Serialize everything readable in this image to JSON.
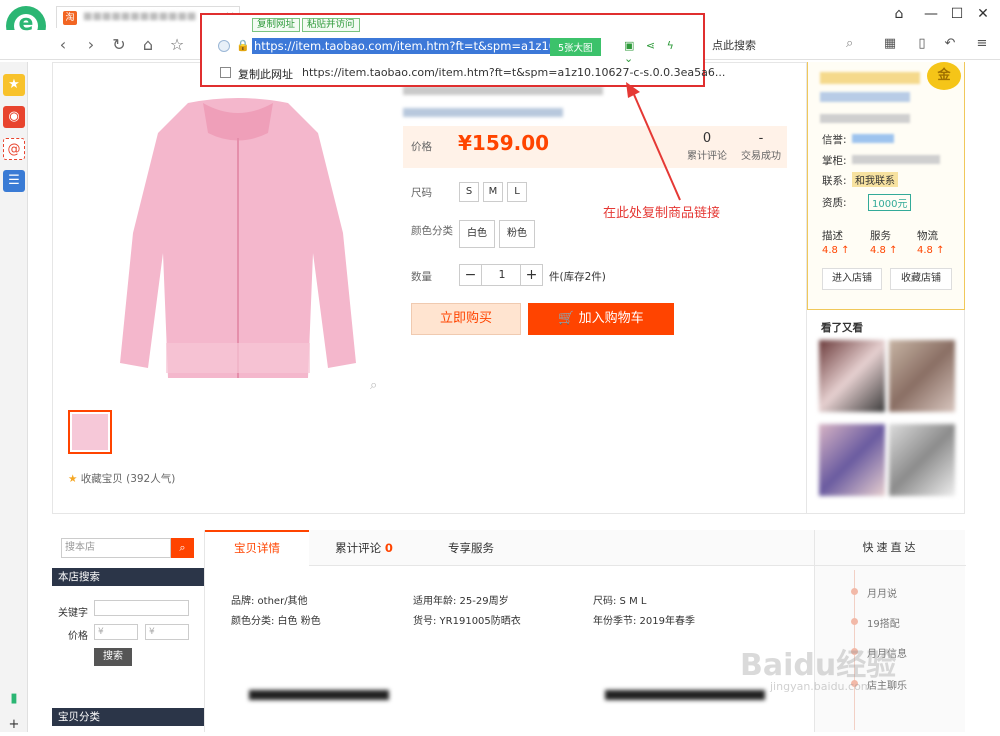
{
  "browser": {
    "tab_favicon": "淘",
    "tab_close": "×",
    "search_label": "点此搜索",
    "colors": {
      "brand_green": "#2bb673",
      "highlight_red": "#e02f2f",
      "url_select": "#3c78d8"
    }
  },
  "url_popup": {
    "copy_url_chip": "复制网址",
    "paste_visit_chip": "粘贴并访问",
    "url": "https://item.taobao.com/item.htm?ft=t&spm=a1z10.1",
    "big_image_button": "5张大图",
    "copy_this_label": "复制此网址",
    "full_url": "https://item.taobao.com/item.htm?ft=t&spm=a1z10.10627-c-s.0.0.3ea5a6..."
  },
  "product": {
    "price_label": "价格",
    "price": "¥159.00",
    "review_count": "0",
    "review_label": "累计评论",
    "sales_count": "-",
    "sales_label": "交易成功",
    "size_label": "尺码",
    "sizes": [
      "S",
      "M",
      "L"
    ],
    "color_label": "颜色分类",
    "colors": [
      "白色",
      "粉色"
    ],
    "qty_label": "数量",
    "qty_minus": "−",
    "qty_value": "1",
    "qty_plus": "+",
    "qty_unit": "件(库存2件)",
    "buy_now": "立即购买",
    "add_to_cart": "加入购物车",
    "favorite": "收藏宝贝 (392人气)"
  },
  "annotation": "在此处复制商品链接",
  "seller": {
    "gold_badge": "金",
    "credit_label": "信誉:",
    "owner_label": "掌柜:",
    "contact_label": "联系:",
    "contact_badge": "和我联系",
    "qualification_label": "资质:",
    "deposit": "1000元",
    "ratings": [
      {
        "label": "描述",
        "value": "4.8 ↑"
      },
      {
        "label": "服务",
        "value": "4.8 ↑"
      },
      {
        "label": "物流",
        "value": "4.8 ↑"
      }
    ],
    "enter_shop": "进入店铺",
    "fav_shop": "收藏店铺",
    "seen_title": "看了又看"
  },
  "shop_search": {
    "placeholder": "搜本店",
    "title": "本店搜索",
    "keyword_label": "关键字",
    "price_label": "价格",
    "price_min": "¥",
    "price_max": "¥",
    "search_btn": "搜索",
    "category_title": "宝贝分类"
  },
  "details": {
    "tabs": [
      {
        "label": "宝贝详情"
      },
      {
        "label": "累计评论",
        "count": "0"
      },
      {
        "label": "专享服务"
      }
    ],
    "attrs": [
      "品牌: other/其他",
      "适用年龄: 25-29周岁",
      "尺码: S M L",
      "颜色分类: 白色 粉色",
      "货号: YR191005防晒衣",
      "年份季节: 2019年春季"
    ]
  },
  "quicknav": {
    "title": "快速直达",
    "items": [
      "月月说",
      "19搭配",
      "月月信息",
      "店主聊乐"
    ]
  },
  "watermark": {
    "main": "Baidu经验",
    "sub": "jingyan.baidu.com"
  }
}
